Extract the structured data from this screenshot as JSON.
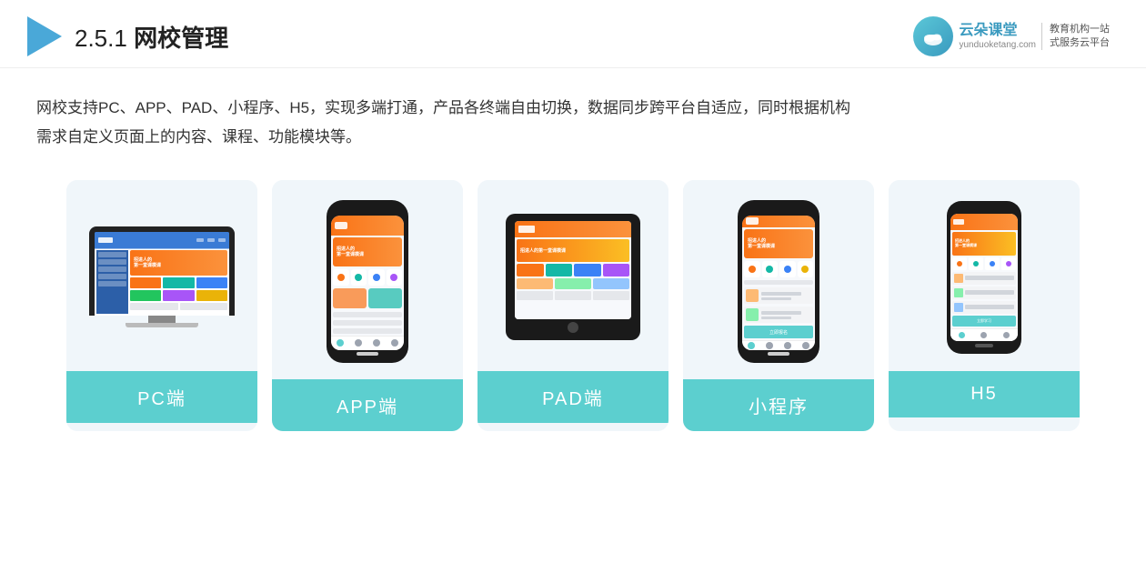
{
  "header": {
    "section_prefix": "2.5.1",
    "title": "网校管理",
    "brand": {
      "name": "云朵课堂",
      "url": "yunduoketang.com",
      "tagline_line1": "教育机构一站",
      "tagline_line2": "式服务云平台"
    }
  },
  "description": {
    "text_line1": "网校支持PC、APP、PAD、小程序、H5，实现多端打通，产品各终端自由切换，数据同步跨平台自适应，同时根据机构",
    "text_line2": "需求自定义页面上的内容、课程、功能模块等。"
  },
  "platforms": [
    {
      "id": "pc",
      "label": "PC端"
    },
    {
      "id": "app",
      "label": "APP端"
    },
    {
      "id": "pad",
      "label": "PAD端"
    },
    {
      "id": "miniprogram",
      "label": "小程序"
    },
    {
      "id": "h5",
      "label": "H5"
    }
  ]
}
